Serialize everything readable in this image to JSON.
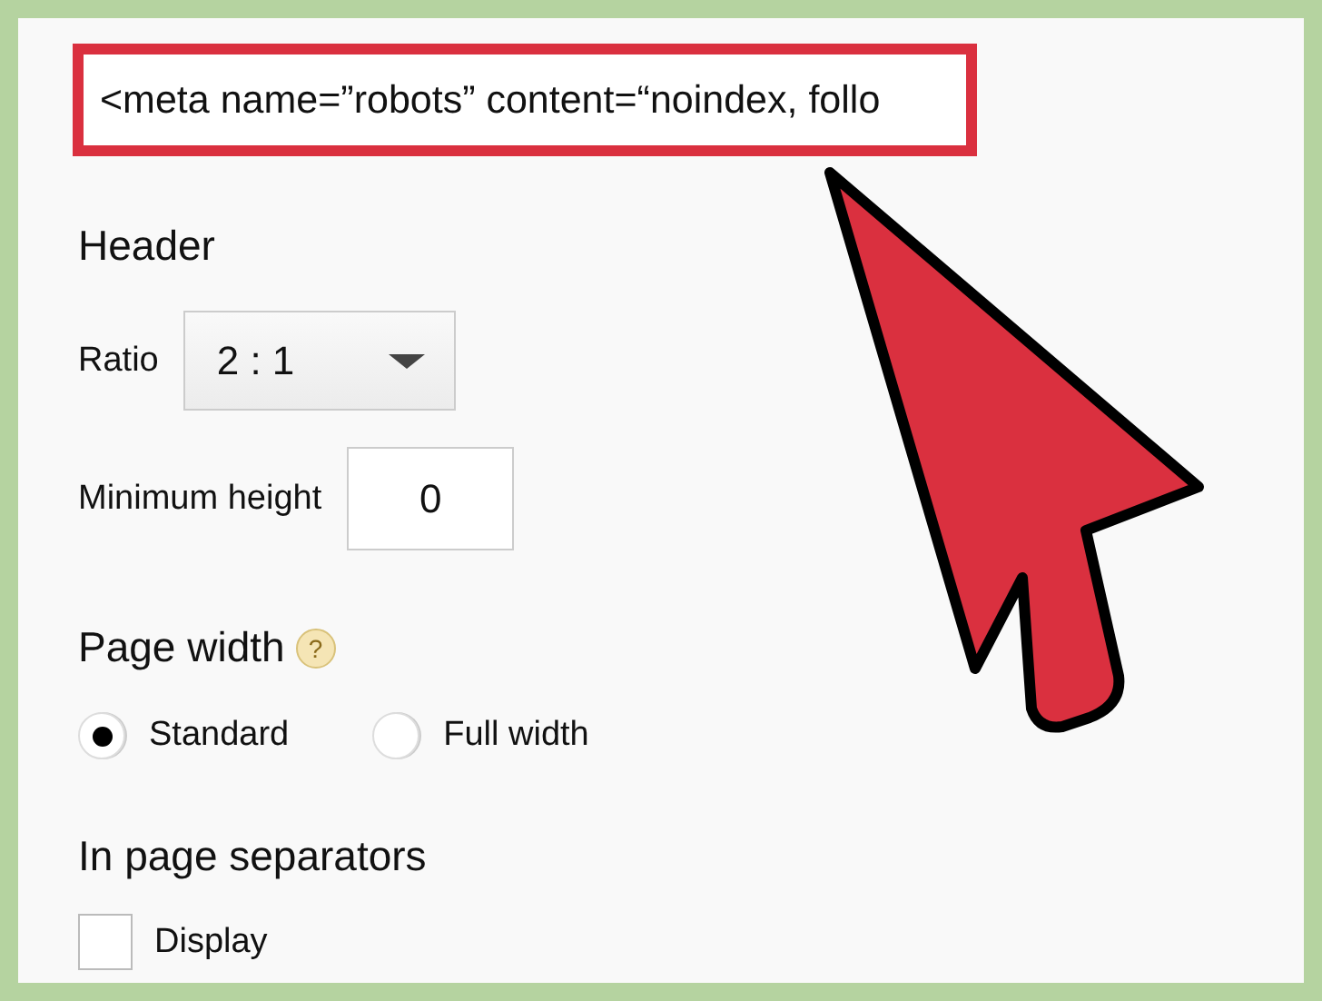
{
  "code_field": {
    "value": "<meta name=”robots” content=“noindex, follo"
  },
  "header": {
    "title": "Header",
    "ratio": {
      "label": "Ratio",
      "value": "2 : 1"
    },
    "minimum_height": {
      "label": "Minimum height",
      "value": "0"
    }
  },
  "page_width": {
    "title": "Page width",
    "help": "?",
    "options": [
      {
        "label": "Standard",
        "selected": true
      },
      {
        "label": "Full width",
        "selected": false
      }
    ]
  },
  "separators": {
    "title": "In page separators",
    "display": {
      "label": "Display",
      "checked": false
    }
  }
}
